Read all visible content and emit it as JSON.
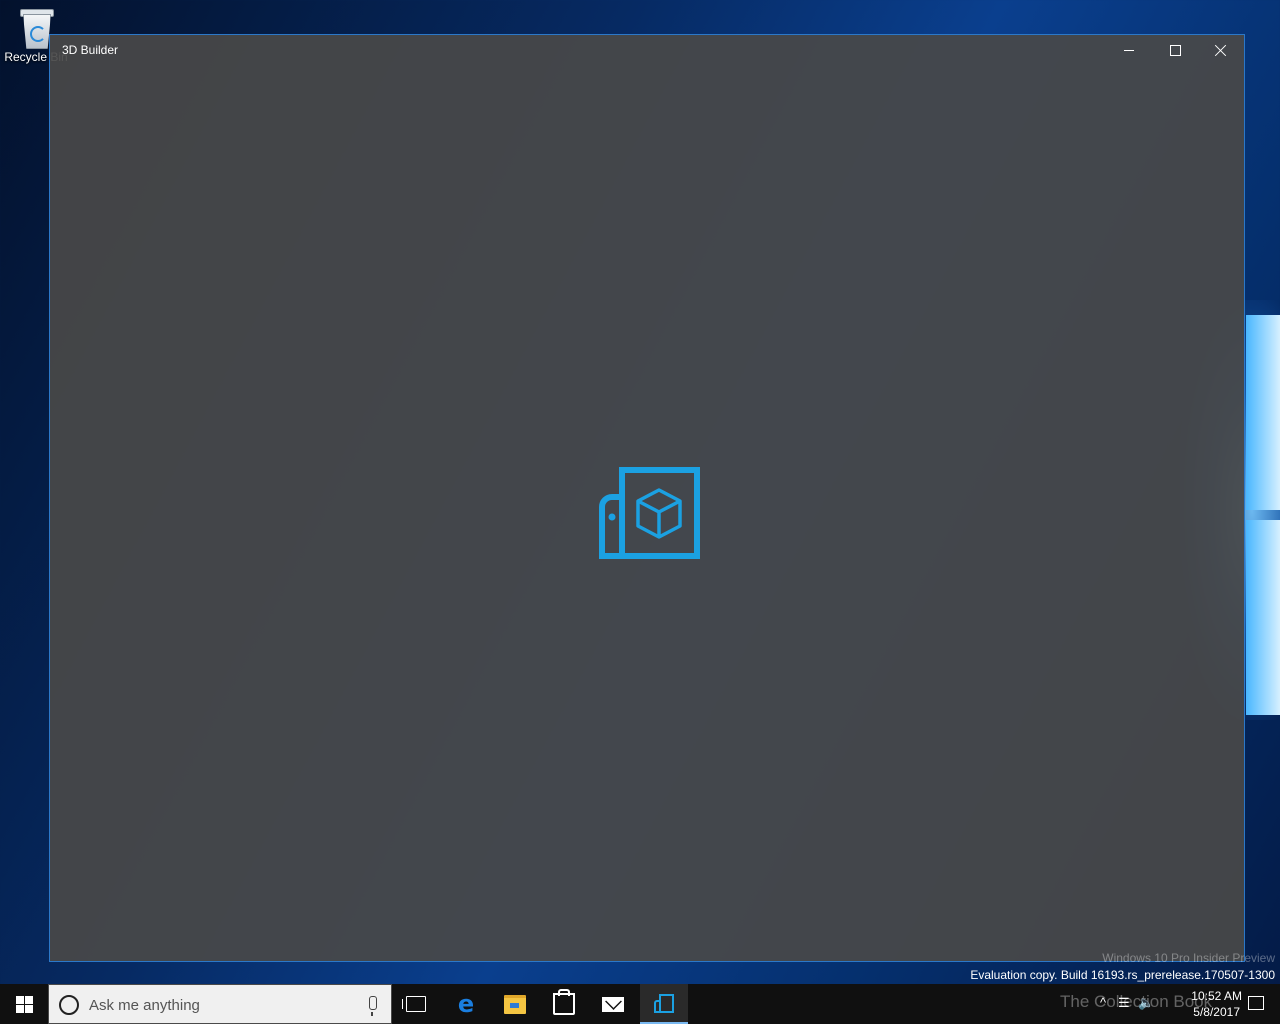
{
  "desktop": {
    "recycle_bin_label": "Recycle Bin"
  },
  "window": {
    "title": "3D Builder",
    "minimize_label": "Minimize",
    "maximize_label": "Maximize",
    "close_label": "Close",
    "accent_color": "#1ba1e2"
  },
  "watermark": {
    "line1": "Windows 10 Pro Insider Preview",
    "line2": "Evaluation copy. Build 16193.rs_prerelease.170507-1300"
  },
  "taskbar": {
    "search_placeholder": "Ask me anything",
    "apps": [
      "task-view",
      "edge",
      "file-explorer",
      "store",
      "mail",
      "3d-builder"
    ],
    "tray_watermark": "The Collection Book",
    "time": "10:52 AM",
    "date": "5/8/2017"
  }
}
